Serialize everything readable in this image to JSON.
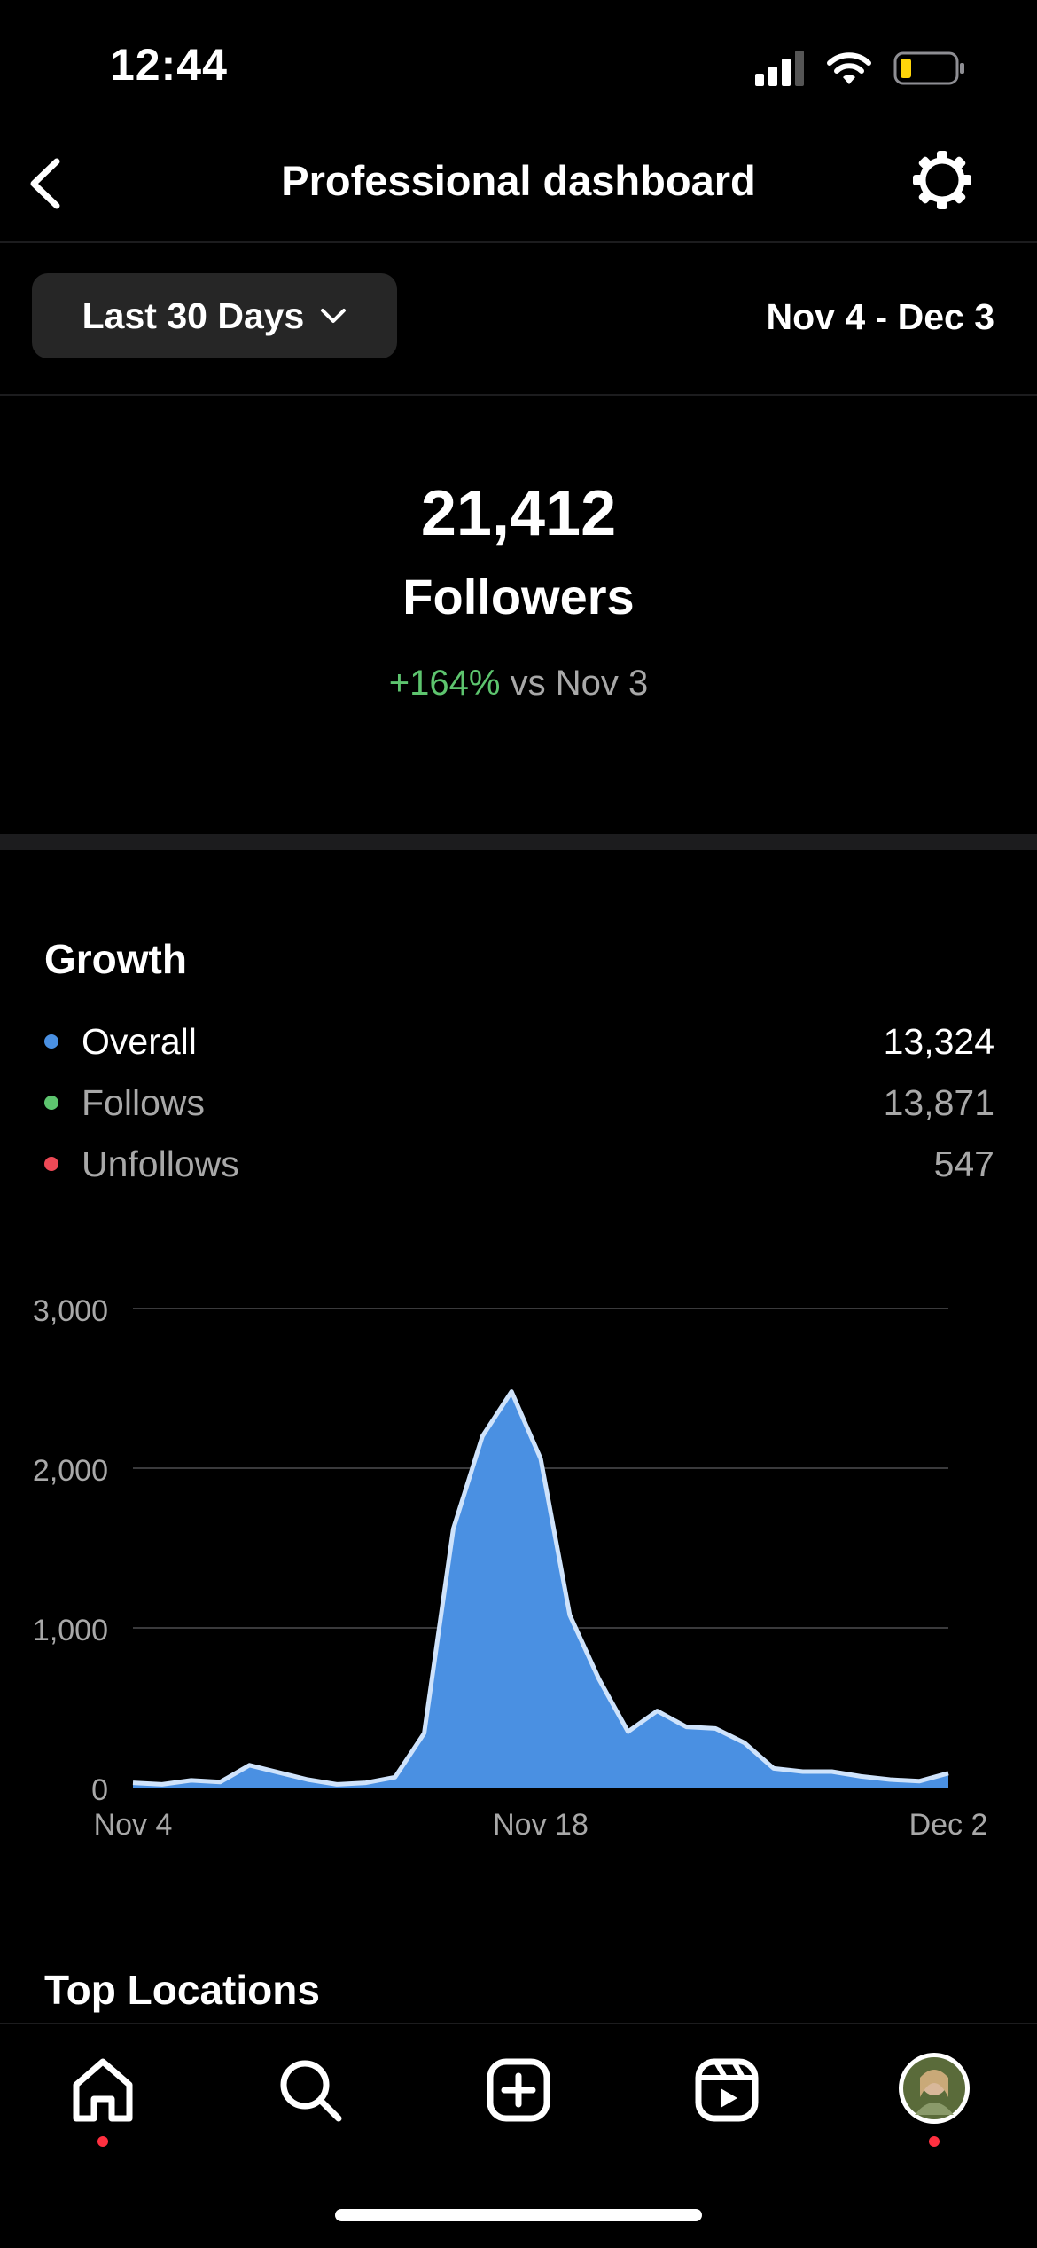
{
  "status_bar": {
    "time": "12:44"
  },
  "nav": {
    "title": "Professional dashboard"
  },
  "range": {
    "selector_label": "Last 30 Days",
    "date_range": "Nov 4 - Dec 3"
  },
  "summary": {
    "followers_count": "21,412",
    "followers_label": "Followers",
    "change_pct": "+164%",
    "change_suffix": "vs Nov 3"
  },
  "growth": {
    "title": "Growth",
    "legend": [
      {
        "name": "Overall",
        "value": "13,324",
        "color": "#4a90e2"
      },
      {
        "name": "Follows",
        "value": "13,871",
        "color": "#5dc46e"
      },
      {
        "name": "Unfollows",
        "value": "547",
        "color": "#ed4956"
      }
    ]
  },
  "chart_data": {
    "type": "area",
    "x_ticks": [
      "Nov 4",
      "Nov 18",
      "Dec 2"
    ],
    "y_ticks": [
      "3,000",
      "2,000",
      "1,000",
      "0"
    ],
    "ylim": [
      0,
      3000
    ],
    "grid": true,
    "series": [
      {
        "name": "Overall",
        "color": "#4a90e2",
        "x": [
          "Nov 4",
          "Nov 5",
          "Nov 6",
          "Nov 7",
          "Nov 8",
          "Nov 9",
          "Nov 10",
          "Nov 11",
          "Nov 12",
          "Nov 13",
          "Nov 14",
          "Nov 15",
          "Nov 16",
          "Nov 17",
          "Nov 18",
          "Nov 19",
          "Nov 20",
          "Nov 21",
          "Nov 22",
          "Nov 23",
          "Nov 24",
          "Nov 25",
          "Nov 26",
          "Nov 27",
          "Nov 28",
          "Nov 29",
          "Nov 30",
          "Dec 1",
          "Dec 2"
        ],
        "values": [
          30,
          20,
          45,
          35,
          140,
          95,
          50,
          20,
          30,
          65,
          340,
          1620,
          2200,
          2480,
          2060,
          1080,
          680,
          350,
          480,
          380,
          370,
          280,
          120,
          100,
          100,
          70,
          50,
          40,
          90
        ]
      }
    ]
  },
  "sections": {
    "top_locations": "Top Locations"
  },
  "tabbar": {
    "items": [
      {
        "icon": "home-icon",
        "has_dot": true
      },
      {
        "icon": "search-icon",
        "has_dot": false
      },
      {
        "icon": "create-icon",
        "has_dot": false
      },
      {
        "icon": "reels-icon",
        "has_dot": false
      },
      {
        "icon": "profile-avatar",
        "has_dot": true
      }
    ]
  },
  "colors": {
    "accent": "#4a90e2",
    "positive": "#5dc46e",
    "notification": "#ff3040"
  }
}
